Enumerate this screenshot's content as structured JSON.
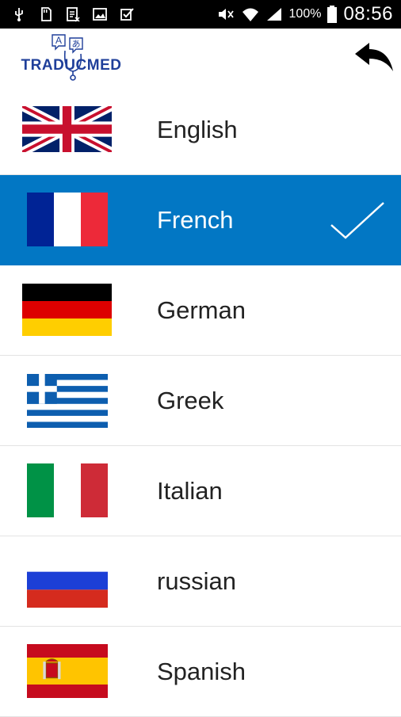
{
  "status_bar": {
    "left_icons": [
      "usb-icon",
      "sd-card-icon",
      "document-icon",
      "image-icon",
      "task-check-icon"
    ],
    "battery_percent": "100%",
    "time": "08:56"
  },
  "app_bar": {
    "logo_text": "TRADUCMED",
    "logo_bubble_a": "A",
    "logo_bubble_b": "あ",
    "back_icon": "reply-back-icon"
  },
  "languages": [
    {
      "name": "English",
      "flag": "uk-flag-icon",
      "selected": false
    },
    {
      "name": "French",
      "flag": "france-flag-icon",
      "selected": true
    },
    {
      "name": "German",
      "flag": "germany-flag-icon",
      "selected": false
    },
    {
      "name": "Greek",
      "flag": "greece-flag-icon",
      "selected": false
    },
    {
      "name": "Italian",
      "flag": "italy-flag-icon",
      "selected": false
    },
    {
      "name": "russian",
      "flag": "russia-flag-icon",
      "selected": false
    },
    {
      "name": "Spanish",
      "flag": "spain-flag-icon",
      "selected": false
    }
  ],
  "colors": {
    "selected_row": "#0277c4",
    "logo_blue": "#1f3f9a"
  }
}
